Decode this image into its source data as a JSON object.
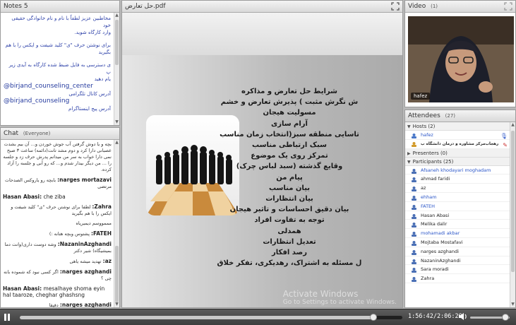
{
  "notes": {
    "title": "Notes",
    "count": "5",
    "lines": [
      "مخاطبین عزیز لطفاً با نام و نام خانوادگی حقیقی خود",
      "وارد کارگاه شوید.",
      "برای نوشتن حرف \"ی\" کلید شیفت و ایکس را با هم",
      "بگیرید",
      "ی دسترسی به فایل ضبط شده کارگاه به آیدی زیر پ",
      "یام دهید"
    ],
    "handle1": "@birjand_counseling_center",
    "handle1_label": "آدرس کانال تلگرامی",
    "handle2": "@birjand_counseling",
    "handle2_label": "آدرس پیج اینستاگرام"
  },
  "chat": {
    "title": "Chat",
    "scope": "(Everyone)",
    "messages": [
      {
        "name": "",
        "text": "بچه و یا دوش گرفتن آب جوش خوردن و... آن بیم بشدت عصبانی دارا کرد و دوم مشد تانت(دائمه) ساعت ۳ صبح نمی دارا خواب به سر من میدانم پدرش حرف زد و جلسه را ... من دیگر بیدار شدم و... که رو آبی و جلسه را آزاد کرده.",
        "ltr": false
      },
      {
        "name": "narges mortazavi:",
        "text": "بابچه رو یاروکس الصدحات مرتضی",
        "ltr": false
      },
      {
        "name": "Hasan Abasi:",
        "text": "che ziba",
        "ltr": true
      },
      {
        "name": "Zahra:",
        "text": "لطفا برای نوشتن حرف \"ی\" کلید شیفت و ایکس را با هم بگیرید",
        "ltr": false
      },
      {
        "name": "",
        "text": "مممووسم دیمیریاه",
        "ltr": false
      },
      {
        "name": "FATEH:",
        "text": "پشتوس وبچه هتانه :)",
        "ltr": false
      },
      {
        "name": "NazaninAzghandi:",
        "text": "وشه دوست داری(وانت دما بمیشیگاه) شیر دکتر",
        "ltr": false
      },
      {
        "name": "az:",
        "text": "تهدید میشه یاهی",
        "ltr": false
      },
      {
        "name": "narges azghandi:",
        "text": "اگر کسی نبود که شموده بانه چی ؟",
        "ltr": false
      },
      {
        "name": "Hasan Abasi:",
        "text": "mesalhaye shoma eyin hal taaroze, cheghar ghashsng",
        "ltr": true
      },
      {
        "name": "narges azghandi:",
        "text": "دقیقا",
        "ltr": false
      }
    ]
  },
  "presentation": {
    "file_title": "حل تعارض.pdf",
    "slide_lines": [
      "شرایط حل تعارض و مذاکره",
      "ش نگرش مثبت ) پذیرش تعارض و خشم",
      "مسولیت هیجان",
      "آرام سازی",
      "تاسایی منطقه سبز(انتخاب زمان مناسب",
      "سبک ارتباطی مناسب",
      "تمرکز روی یک موضوع",
      "وقایع گذشته (سبد لباس چرک)",
      "پیام من",
      "بیان مناسب",
      "بیان انتظارات",
      "بیان دقیق احساسات و تاثیر هیجان",
      "توجه به تفاوت افراد",
      "همدلی",
      "تعدیل انتظارات",
      "رصد افکار",
      "ل مسئله  به اشتراک، رهدیکری، تفکر خلاق"
    ],
    "watermark_line1": "Activate Windows",
    "watermark_line2": "Go to Settings to activate Windows."
  },
  "video": {
    "title": "Video",
    "count": "(1)",
    "camera_name": "hafez"
  },
  "attendees": {
    "title": "Attendees",
    "count": "(27)",
    "hosts_label": "Hosts (2)",
    "hosts": [
      "hafez",
      "رهجاب‌مرکز مشاوره و درمان دانشگاه ب"
    ],
    "presenters_label": "Presenters (0)",
    "participants_label": "Participants (25)",
    "participants": [
      {
        "name": "Afsaneh khodayari moghadam",
        "blue": true
      },
      {
        "name": "ahmad faridi",
        "blue": false
      },
      {
        "name": "az",
        "blue": false
      },
      {
        "name": "ehham",
        "blue": true
      },
      {
        "name": "FATEH",
        "blue": true
      },
      {
        "name": "Hasan Abasi",
        "blue": false
      },
      {
        "name": "Melika dalir",
        "blue": false
      },
      {
        "name": "mohamadi akbar",
        "blue": true
      },
      {
        "name": "Mojtaba Mostafavi",
        "blue": false
      },
      {
        "name": "narges azghandi",
        "blue": false
      },
      {
        "name": "NazaninAzghandi",
        "blue": false
      },
      {
        "name": "Sara moradi",
        "blue": false
      },
      {
        "name": "Zahra",
        "blue": false
      }
    ]
  },
  "playback": {
    "current_time": "1:56:42",
    "total_time": "2:06:20",
    "time_display": "1:56:42/2:06:20",
    "progress_fraction": 0.924,
    "volume_fraction": 0.9
  },
  "icons": {
    "pause": "pause-icon",
    "volume": "volume-icon",
    "fullscreen": "fullscreen-icon"
  }
}
